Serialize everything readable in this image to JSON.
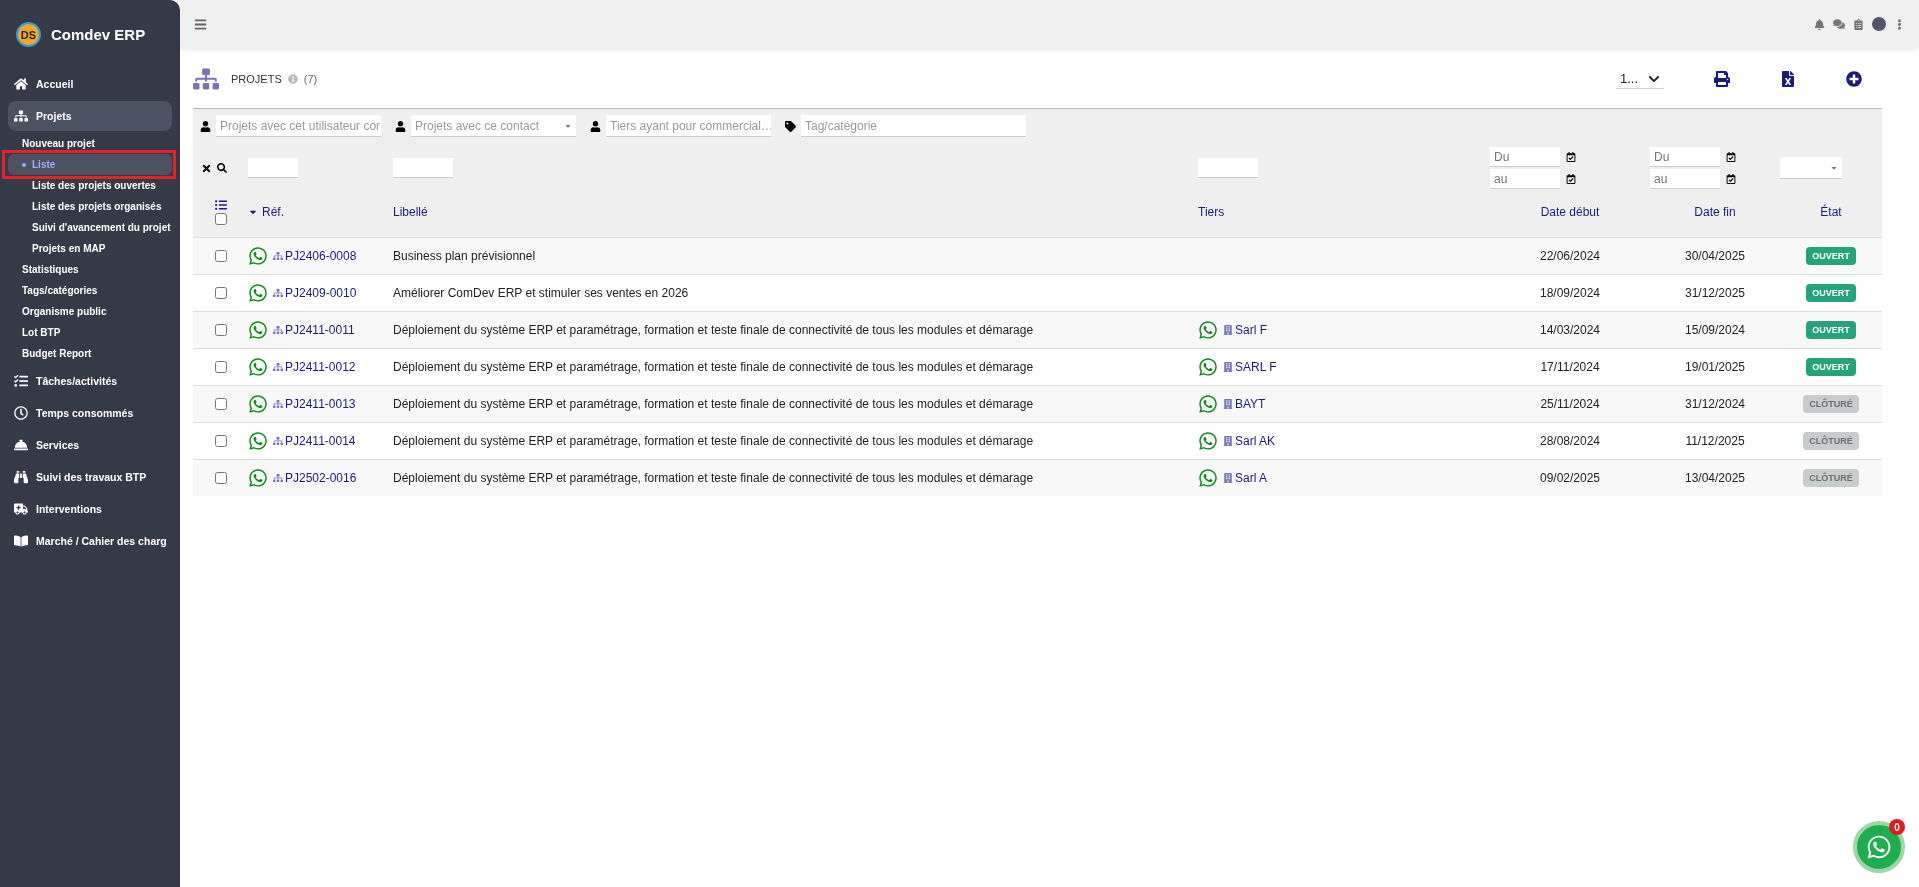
{
  "app": {
    "name": "Comdev ERP",
    "logo": "DS"
  },
  "sidebar": {
    "items": [
      {
        "label": "Accueil",
        "selected": false
      },
      {
        "label": "Projets",
        "selected": true,
        "children": [
          {
            "label": "Nouveau projet",
            "selected": false
          },
          {
            "label": "Liste",
            "selected": true,
            "annotated": true,
            "children": [
              {
                "label": "Liste des projets ouvertes",
                "selected": false
              },
              {
                "label": "Liste des projets organisés",
                "selected": false
              },
              {
                "label": "Suivi d'avancement du projet",
                "selected": false
              },
              {
                "label": "Projets en MAP",
                "selected": false
              }
            ]
          },
          {
            "label": "Statistiques",
            "selected": false
          },
          {
            "label": "Tags/catégories",
            "selected": false
          },
          {
            "label": "Organisme public",
            "selected": false
          },
          {
            "label": "Lot BTP",
            "selected": false
          },
          {
            "label": "Budget Report",
            "selected": false
          }
        ]
      },
      {
        "label": "Tâches/activités",
        "selected": false
      },
      {
        "label": "Temps consommés",
        "selected": false
      },
      {
        "label": "Services",
        "selected": false
      },
      {
        "label": "Suivi des travaux BTP",
        "selected": false
      },
      {
        "label": "Interventions",
        "selected": false
      },
      {
        "label": "Marché / Cahier des charg",
        "selected": false
      }
    ]
  },
  "page": {
    "title": "PROJETS",
    "count": "(7)",
    "per_page": "1..."
  },
  "filters": [
    {
      "placeholder": "Projets avec cet utilisateur cor",
      "kind": "user"
    },
    {
      "placeholder": "Projets avec ce contact",
      "kind": "user"
    },
    {
      "placeholder": "Tiers ayant pour commercial…",
      "kind": "user"
    },
    {
      "placeholder": "Tag/catégorie",
      "kind": "tag"
    }
  ],
  "date_filters": [
    {
      "from": {
        "placeholder": "Du"
      },
      "to": {
        "placeholder": "au"
      }
    },
    {
      "from": {
        "placeholder": "Du"
      },
      "to": {
        "placeholder": "au"
      }
    }
  ],
  "table": {
    "select_all_checked": false,
    "columns": [
      {
        "label": "Réf.",
        "sorted": true
      },
      {
        "label": "Libellé",
        "sorted": false
      },
      {
        "label": "Tiers",
        "sorted": false
      },
      {
        "label": "Date début",
        "sorted": false
      },
      {
        "label": "Date fin",
        "sorted": false
      },
      {
        "label": "État",
        "sorted": false
      }
    ],
    "rows": [
      {
        "ref": "PJ2406-0008",
        "label": "Business plan prévisionnel",
        "tiers": "",
        "start": "22/06/2024",
        "end": "30/04/2025",
        "status": "OUVERT",
        "kind": "open",
        "checked": false
      },
      {
        "ref": "PJ2409-0010",
        "label": "Améliorer ComDev ERP et stimuler ses ventes en 2026",
        "tiers": "",
        "start": "18/09/2024",
        "end": "31/12/2025",
        "status": "OUVERT",
        "kind": "open",
        "checked": false
      },
      {
        "ref": "PJ2411-0011",
        "label": "Déploiement du système ERP et paramétrage, formation et teste finale de connectivité de tous les modules et démarage",
        "tiers": "Sarl F",
        "start": "14/03/2024",
        "end": "15/09/2024",
        "status": "OUVERT",
        "kind": "open",
        "checked": false
      },
      {
        "ref": "PJ2411-0012",
        "label": "Déploiement du système ERP et paramétrage, formation et teste finale de connectivité de tous les modules et démarage",
        "tiers": "SARL F",
        "start": "17/11/2024",
        "end": "19/01/2025",
        "status": "OUVERT",
        "kind": "open",
        "checked": false
      },
      {
        "ref": "PJ2411-0013",
        "label": "Déploiement du système ERP et paramétrage, formation et teste finale de connectivité de tous les modules et démarage",
        "tiers": "BAYT",
        "start": "25/11/2024",
        "end": "31/12/2024",
        "status": "CLÔTURÉ",
        "kind": "closed",
        "checked": false
      },
      {
        "ref": "PJ2411-0014",
        "label": "Déploiement du système ERP et paramétrage, formation et teste finale de connectivité de tous les modules et démarage",
        "tiers": "Sarl AK",
        "start": "28/08/2024",
        "end": "11/12/2025",
        "status": "CLÔTURÉ",
        "kind": "closed",
        "checked": false
      },
      {
        "ref": "PJ2502-0016",
        "label": "Déploiement du système ERP et paramétrage, formation et teste finale de connectivité de tous les modules et démarage",
        "tiers": "Sarl A",
        "start": "09/02/2025",
        "end": "13/04/2025",
        "status": "CLÔTURÉ",
        "kind": "closed",
        "checked": false
      }
    ]
  },
  "chat_widget": {
    "badge": "0"
  }
}
